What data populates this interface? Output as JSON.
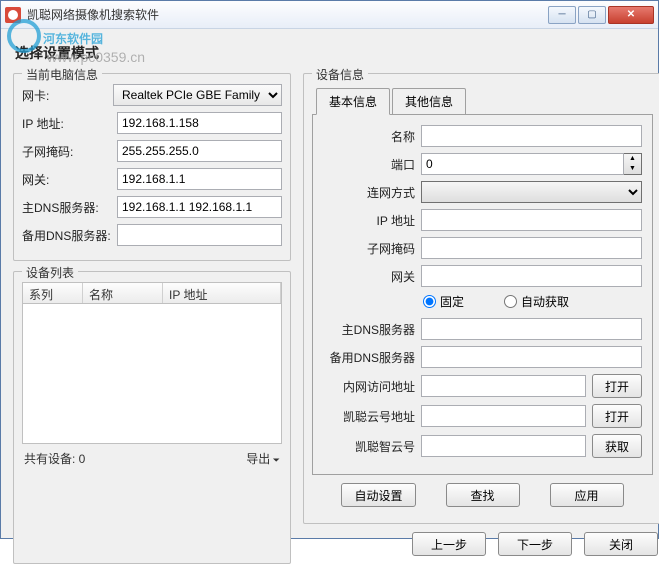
{
  "window": {
    "title": "凯聪网络摄像机搜索软件"
  },
  "watermark": {
    "text": "河东软件园",
    "url": "www.pc0359.cn"
  },
  "heading": "选择设置模式",
  "local": {
    "legend": "当前电脑信息",
    "nic_label": "网卡:",
    "nic_value": "Realtek PCIe GBE Family",
    "ip_label": "IP 地址:",
    "ip_value": "192.168.1.158",
    "mask_label": "子网掩码:",
    "mask_value": "255.255.255.0",
    "gateway_label": "网关:",
    "gateway_value": "192.168.1.1",
    "dns1_label": "主DNS服务器:",
    "dns1_value": "192.168.1.1 192.168.1.1",
    "dns2_label": "备用DNS服务器:",
    "dns2_value": ""
  },
  "devlist": {
    "legend": "设备列表",
    "col_series": "系列",
    "col_name": "名称",
    "col_ip": "IP 地址",
    "total_label": "共有设备: 0",
    "export_label": "导出"
  },
  "devinfo": {
    "legend": "设备信息",
    "tab_basic": "基本信息",
    "tab_other": "其他信息",
    "name_label": "名称",
    "port_label": "端口",
    "port_value": "0",
    "conn_label": "连网方式",
    "ip_label": "IP 地址",
    "mask_label": "子网掩码",
    "gateway_label": "网关",
    "radio_fixed": "固定",
    "radio_auto": "自动获取",
    "dns1_label": "主DNS服务器",
    "dns2_label": "备用DNS服务器",
    "lan_label": "内网访问地址",
    "cloud_label": "凯聪云号地址",
    "smart_label": "凯聪智云号",
    "open_btn": "打开",
    "get_btn": "获取",
    "autoset_btn": "自动设置",
    "search_btn": "查找",
    "apply_btn": "应用"
  },
  "footer": {
    "prev": "上一步",
    "next": "下一步",
    "close": "关闭"
  }
}
